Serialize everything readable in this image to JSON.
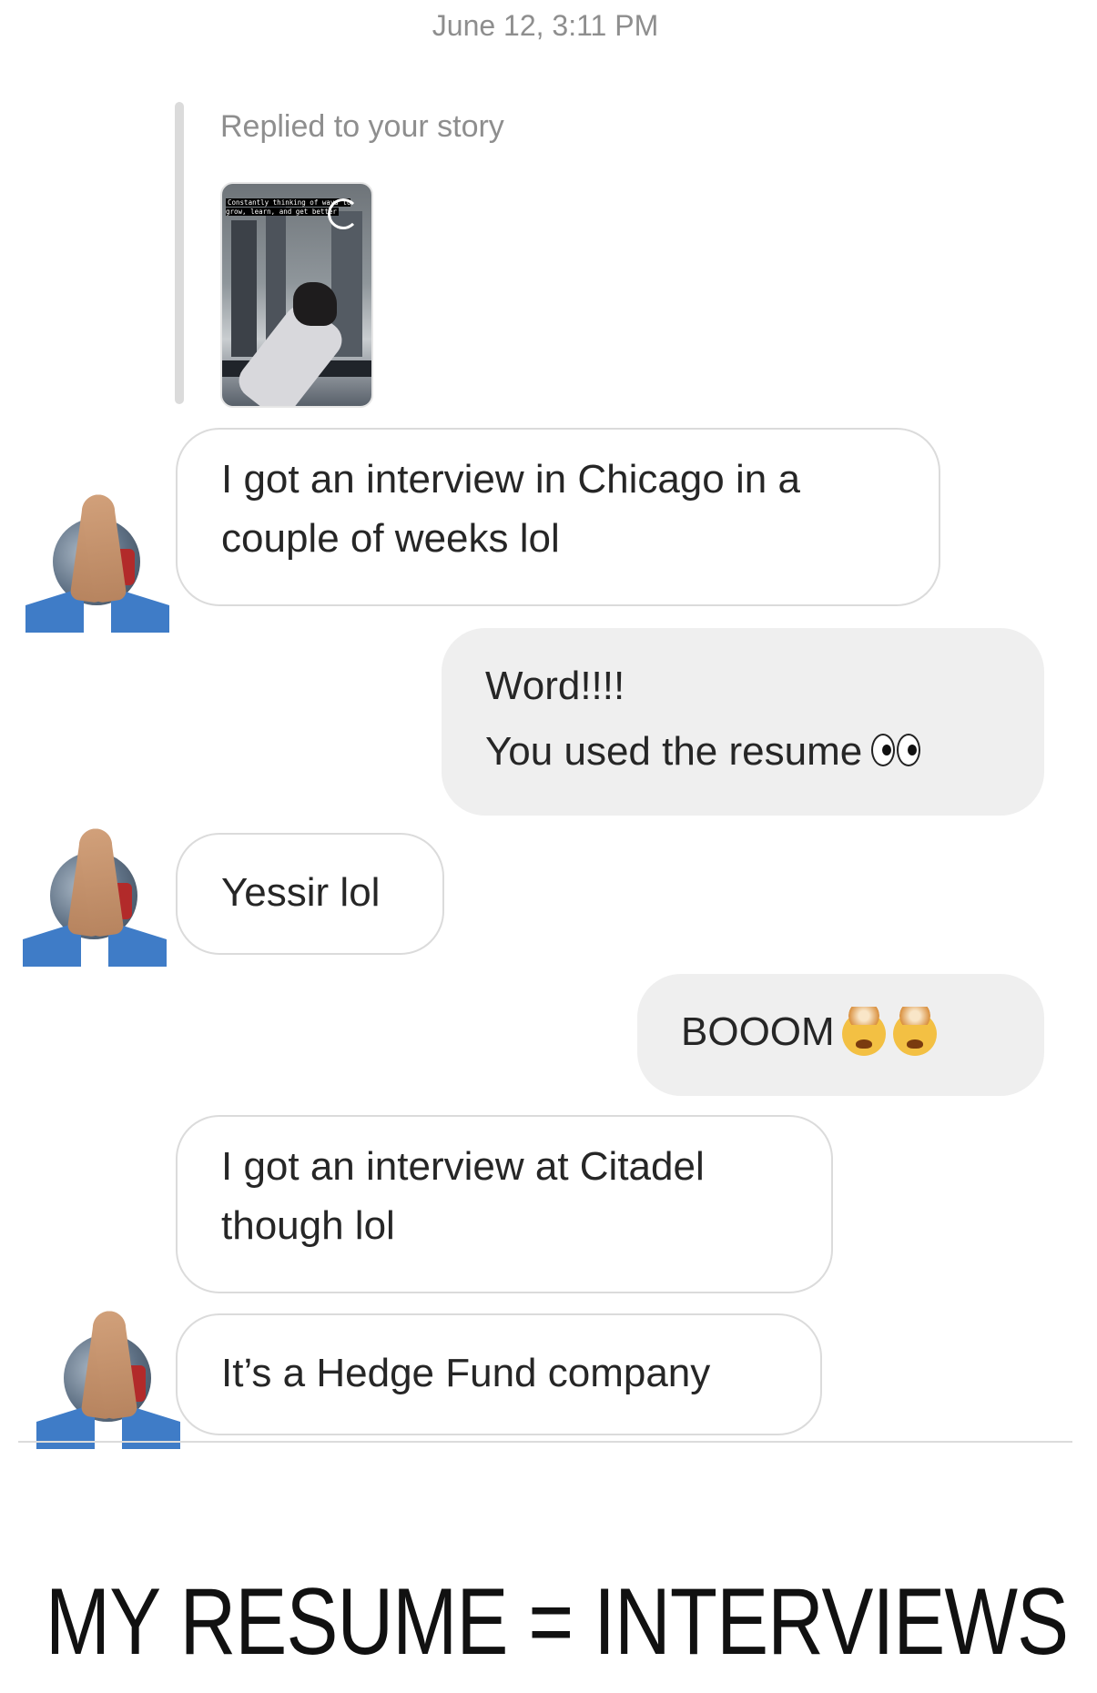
{
  "chat": {
    "timestamp": "June 12, 3:11 PM",
    "story_reply": {
      "caption": "Replied to your story",
      "thumbnail_text": "Constantly thinking of ways to grow, learn, and get better"
    },
    "messages": [
      {
        "from": "them",
        "text": "I got an interview in Chicago in a couple of weeks lol"
      },
      {
        "from": "me",
        "line1": "Word!!!!",
        "line2": "You used the resume",
        "emoji": "eyes-emoji"
      },
      {
        "from": "them",
        "text": "Yessir lol"
      },
      {
        "from": "me",
        "text": "BOOOM",
        "emoji": "exploding-head-emoji"
      },
      {
        "from": "them",
        "text": "I got an interview at Citadel though lol"
      },
      {
        "from": "them",
        "text": "It’s a Hedge Fund company"
      }
    ],
    "avatar_icon": "praying-hands-avatar"
  },
  "overlay_caption": "MY RESUME = INTERVIEWS",
  "colors": {
    "incoming_border": "#dbdbdb",
    "outgoing_bg": "#efefef",
    "meta_text": "#8e8e8e"
  }
}
